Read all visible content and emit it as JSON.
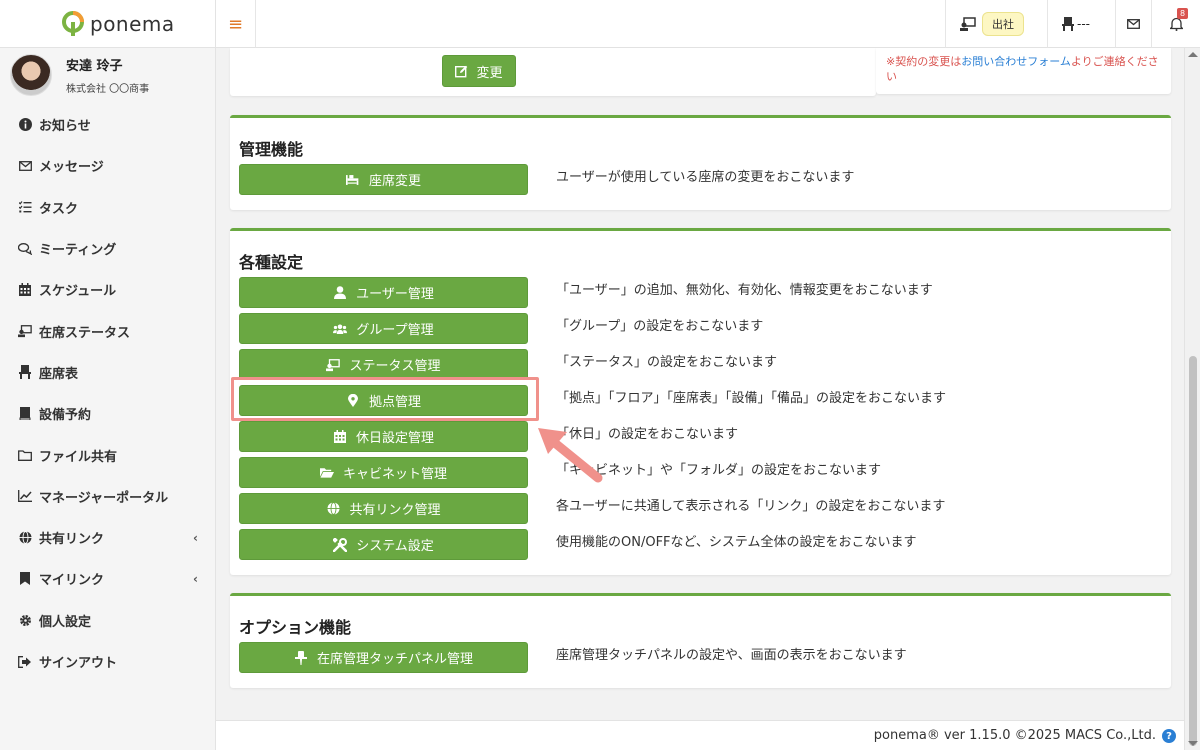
{
  "brand": {
    "name": "ponema"
  },
  "header": {
    "menu_icon": "hamburger-icon",
    "status_label": "出社",
    "seat_label": "---",
    "notification_count": "8"
  },
  "user": {
    "name": "安達 玲子",
    "company": "株式会社 〇〇商事"
  },
  "sidebar": {
    "items": [
      {
        "label": "お知らせ",
        "icon": "info-icon"
      },
      {
        "label": "メッセージ",
        "icon": "mail-icon"
      },
      {
        "label": "タスク",
        "icon": "task-list-icon"
      },
      {
        "label": "ミーティング",
        "icon": "comments-icon"
      },
      {
        "label": "スケジュール",
        "icon": "calendar-icon"
      },
      {
        "label": "在席ステータス",
        "icon": "presence-icon"
      },
      {
        "label": "座席表",
        "icon": "chair-icon"
      },
      {
        "label": "設備予約",
        "icon": "book-icon"
      },
      {
        "label": "ファイル共有",
        "icon": "folder-icon"
      },
      {
        "label": "マネージャーポータル",
        "icon": "chart-icon"
      },
      {
        "label": "共有リンク",
        "icon": "globe-icon",
        "chevron": "‹"
      },
      {
        "label": "マイリンク",
        "icon": "bookmark-icon",
        "chevron": "‹"
      },
      {
        "label": "個人設定",
        "icon": "gear-icon"
      },
      {
        "label": "サインアウト",
        "icon": "sign-out-icon"
      }
    ]
  },
  "top": {
    "change_button": "変更",
    "notice_prefix": "※契約の変更は",
    "notice_link": "お問い合わせフォーム",
    "notice_suffix": "よりご連絡ください"
  },
  "admin": {
    "title": "管理機能",
    "items": [
      {
        "label": "座席変更",
        "icon": "seat-change-icon",
        "desc": "ユーザーが使用している座席の変更をおこないます"
      }
    ]
  },
  "settings": {
    "title": "各種設定",
    "items": [
      {
        "label": "ユーザー管理",
        "icon": "user-icon",
        "desc": "「ユーザー」の追加、無効化、有効化、情報変更をおこないます"
      },
      {
        "label": "グループ管理",
        "icon": "users-icon",
        "desc": "「グループ」の設定をおこないます"
      },
      {
        "label": "ステータス管理",
        "icon": "presence-icon",
        "desc": "「ステータス」の設定をおこないます"
      },
      {
        "label": "拠点管理",
        "icon": "map-marker-icon",
        "desc": "「拠点」「フロア」「座席表」「設備」「備品」の設定をおこないます"
      },
      {
        "label": "休日設定管理",
        "icon": "calendar-icon",
        "desc": "「休日」の設定をおこないます"
      },
      {
        "label": "キャビネット管理",
        "icon": "folder-open-icon",
        "desc": "「キャビネット」や「フォルダ」の設定をおこないます"
      },
      {
        "label": "共有リンク管理",
        "icon": "globe-icon",
        "desc": "各ユーザーに共通して表示される「リンク」の設定をおこないます"
      },
      {
        "label": "システム設定",
        "icon": "tools-icon",
        "desc": "使用機能のON/OFFなど、システム全体の設定をおこないます"
      }
    ]
  },
  "options": {
    "title": "オプション機能",
    "items": [
      {
        "label": "在席管理タッチパネル管理",
        "icon": "pointer-icon",
        "desc": "座席管理タッチパネルの設定や、画面の表示をおこないます"
      }
    ]
  },
  "footer": {
    "text": "ponema® ver 1.15.0 ©2025 MACS Co.,Ltd.",
    "help": "?"
  },
  "colors": {
    "accent_green": "#6aa842",
    "highlight": "#f0918b",
    "notice_red": "#d9534f",
    "link_blue": "#2a7fd4"
  }
}
